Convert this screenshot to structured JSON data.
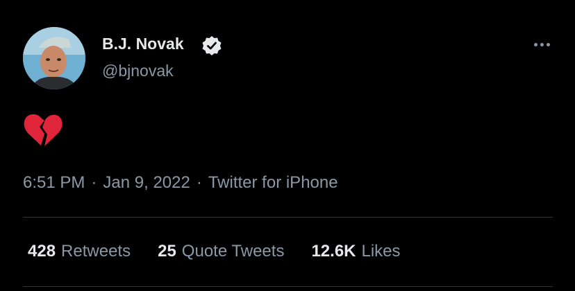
{
  "author": {
    "display_name": "B.J. Novak",
    "handle": "@bjnovak",
    "verified": true,
    "avatar_icon": "profile-photo"
  },
  "tweet": {
    "content_emoji": "broken-heart",
    "timestamp": "6:51 PM · Jan 9, 2022",
    "time": "6:51 PM",
    "date": "Jan 9, 2022",
    "source": "Twitter for iPhone",
    "separator": "·"
  },
  "stats": [
    {
      "count": "428",
      "label": "Retweets"
    },
    {
      "count": "25",
      "label": "Quote Tweets"
    },
    {
      "count": "12.6K",
      "label": "Likes"
    }
  ],
  "colors": {
    "background": "#000000",
    "primary_text": "#e7e9ea",
    "secondary_text": "#8b98a5",
    "divider": "#2f3336",
    "heart": "#e0243a"
  }
}
